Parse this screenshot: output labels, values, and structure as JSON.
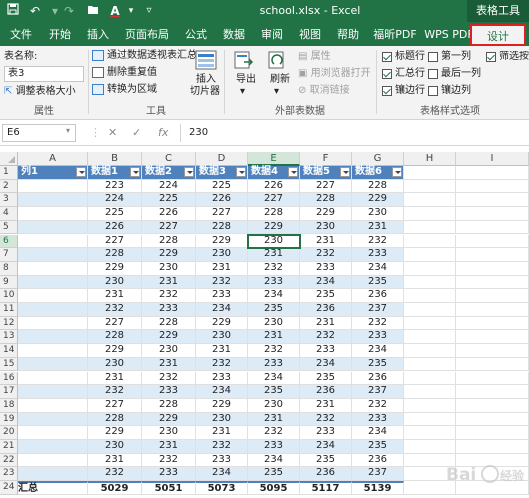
{
  "title_bar": {
    "document_title": "school.xlsx - Excel",
    "context_title": "表格工具",
    "quick_access": [
      "save-icon",
      "undo-icon",
      "redo-icon",
      "folder-icon",
      "font-color-icon",
      "customize-icon"
    ]
  },
  "tabs": [
    {
      "label": "文件",
      "active": false
    },
    {
      "label": "开始",
      "active": false
    },
    {
      "label": "插入",
      "active": false
    },
    {
      "label": "页面布局",
      "active": false
    },
    {
      "label": "公式",
      "active": false
    },
    {
      "label": "数据",
      "active": false
    },
    {
      "label": "审阅",
      "active": false
    },
    {
      "label": "视图",
      "active": false
    },
    {
      "label": "帮助",
      "active": false
    },
    {
      "label": "福昕PDF",
      "active": false
    },
    {
      "label": "WPS PDF",
      "active": false
    },
    {
      "label": "设计",
      "active": true
    }
  ],
  "ribbon": {
    "properties": {
      "name_label": "表名称:",
      "name_value": "表3",
      "resize_label": "调整表格大小",
      "group_label": "属性"
    },
    "tools": {
      "pivot_label": "通过数据透视表汇总",
      "dedupe_label": "删除重复值",
      "convert_label": "转换为区域",
      "slicer_label_1": "插入",
      "slicer_label_2": "切片器",
      "group_label": "工具"
    },
    "external": {
      "export_label": "导出",
      "refresh_label": "刷新",
      "properties_label": "属性",
      "browser_label": "用浏览器打开",
      "unlink_label": "取消链接",
      "group_label": "外部表数据"
    },
    "style_options": {
      "header_row": {
        "label": "标题行",
        "checked": true
      },
      "total_row": {
        "label": "汇总行",
        "checked": true
      },
      "banded_rows": {
        "label": "镶边行",
        "checked": true
      },
      "first_column": {
        "label": "第一列",
        "checked": false
      },
      "last_column": {
        "label": "最后一列",
        "checked": false
      },
      "banded_columns": {
        "label": "镶边列",
        "checked": false
      },
      "filter_button": {
        "label": "筛选按钮",
        "checked": true
      },
      "group_label": "表格样式选项"
    }
  },
  "formula_bar": {
    "name_box": "E6",
    "value": "230",
    "fx": "fx"
  },
  "sheet": {
    "columns": [
      "A",
      "B",
      "C",
      "D",
      "E",
      "F",
      "G",
      "H",
      "I"
    ],
    "active_column": "E",
    "active_row": 6,
    "header_row": [
      "列1",
      "数据1",
      "数据2",
      "数据3",
      "数据4",
      "数据5",
      "数据6"
    ],
    "data_rows": [
      [
        "",
        "223",
        "224",
        "225",
        "226",
        "227",
        "228"
      ],
      [
        "",
        "224",
        "225",
        "226",
        "227",
        "228",
        "229"
      ],
      [
        "",
        "225",
        "226",
        "227",
        "228",
        "229",
        "230"
      ],
      [
        "",
        "226",
        "227",
        "228",
        "229",
        "230",
        "231"
      ],
      [
        "",
        "227",
        "228",
        "229",
        "230",
        "231",
        "232"
      ],
      [
        "",
        "228",
        "229",
        "230",
        "231",
        "232",
        "233"
      ],
      [
        "",
        "229",
        "230",
        "231",
        "232",
        "233",
        "234"
      ],
      [
        "",
        "230",
        "231",
        "232",
        "233",
        "234",
        "235"
      ],
      [
        "",
        "231",
        "232",
        "233",
        "234",
        "235",
        "236"
      ],
      [
        "",
        "232",
        "233",
        "234",
        "235",
        "236",
        "237"
      ],
      [
        "",
        "227",
        "228",
        "229",
        "230",
        "231",
        "232"
      ],
      [
        "",
        "228",
        "229",
        "230",
        "231",
        "232",
        "233"
      ],
      [
        "",
        "229",
        "230",
        "231",
        "232",
        "233",
        "234"
      ],
      [
        "",
        "230",
        "231",
        "232",
        "233",
        "234",
        "235"
      ],
      [
        "",
        "231",
        "232",
        "233",
        "234",
        "235",
        "236"
      ],
      [
        "",
        "232",
        "233",
        "234",
        "235",
        "236",
        "237"
      ],
      [
        "",
        "227",
        "228",
        "229",
        "230",
        "231",
        "232"
      ],
      [
        "",
        "228",
        "229",
        "230",
        "231",
        "232",
        "233"
      ],
      [
        "",
        "229",
        "230",
        "231",
        "232",
        "233",
        "234"
      ],
      [
        "",
        "230",
        "231",
        "232",
        "233",
        "234",
        "235"
      ],
      [
        "",
        "231",
        "232",
        "233",
        "234",
        "235",
        "236"
      ],
      [
        "",
        "232",
        "233",
        "234",
        "235",
        "236",
        "237"
      ]
    ],
    "total_row": [
      "汇总",
      "5029",
      "5051",
      "5073",
      "5095",
      "5117",
      "5139"
    ],
    "row_numbers": [
      "1",
      "2",
      "3",
      "4",
      "5",
      "6",
      "7",
      "8",
      "9",
      "10",
      "11",
      "12",
      "13",
      "14",
      "15",
      "16",
      "17",
      "18",
      "19",
      "20",
      "21",
      "22",
      "23",
      "24"
    ]
  },
  "colors": {
    "excel_green": "#217346",
    "table_header": "#4f81bd",
    "band": "#ddebf7",
    "highlight_border": "#e02020"
  }
}
